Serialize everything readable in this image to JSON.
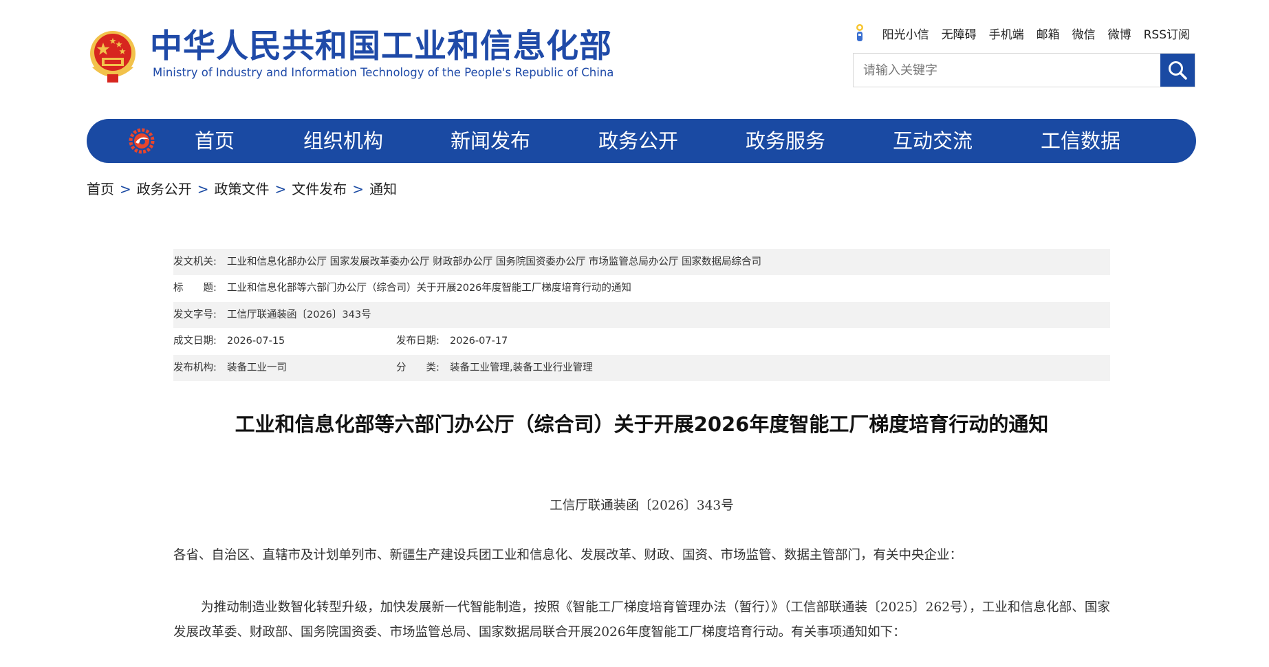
{
  "colors": {
    "brand_blue": "#1a4aa3",
    "title_blue": "#1f4aa8",
    "shade_gray": "#f2f2f2",
    "emblem_red": "#d7261f",
    "emblem_gold": "#f2c24b"
  },
  "header": {
    "title": "中华人民共和国工业和信息化部",
    "subtitle": "Ministry of Industry and Information Technology of the People's Republic of China",
    "links": [
      "阳光小信",
      "无障碍",
      "手机端",
      "邮箱",
      "微信",
      "微博",
      "RSS订阅"
    ],
    "search_placeholder": "请输入关键字",
    "emblem_icon": "national-emblem-icon",
    "search_icon": "search-icon"
  },
  "nav": {
    "logo_icon": "miit-logo-icon",
    "items": [
      "首页",
      "组织机构",
      "新闻发布",
      "政务公开",
      "政务服务",
      "互动交流",
      "工信数据"
    ]
  },
  "breadcrumb": [
    "首页",
    "政务公开",
    "政策文件",
    "文件发布",
    "通知"
  ],
  "breadcrumb_separator": ">",
  "meta": {
    "issuer_label": "发文机关:",
    "issuer": "工业和信息化部办公厅 国家发展改革委办公厅 财政部办公厅 国务院国资委办公厅 市场监管总局办公厅 国家数据局综合司",
    "title_label": "标　　题:",
    "title": "工业和信息化部等六部门办公厅（综合司）关于开展2026年度智能工厂梯度培育行动的通知",
    "docno_label": "发文字号:",
    "docno": "工信厅联通装函〔2026〕343号",
    "written_label": "成文日期:",
    "written": "2026-07-15",
    "published_label": "发布日期:",
    "published": "2026-07-17",
    "publisher_label": "发布机构:",
    "publisher": "装备工业一司",
    "category_label": "分　　类:",
    "category": "装备工业管理,装备工业行业管理"
  },
  "article": {
    "title": "工业和信息化部等六部门办公厅（综合司）关于开展2026年度智能工厂梯度培育行动的通知",
    "doc_number": "工信厅联通装函〔2026〕343号",
    "addressee": "各省、自治区、直辖市及计划单列市、新疆生产建设兵团工业和信息化、发展改革、财政、国资、市场监管、数据主管部门，有关中央企业：",
    "paragraph1": "为推动制造业数智化转型升级，加快发展新一代智能制造，按照《智能工厂梯度培育管理办法（暂行）》（工信部联通装〔2025〕262号），工业和信息化部、国家发展改革委、财政部、国务院国资委、市场监管总局、国家数据局联合开展2026年度智能工厂梯度培育行动。有关事项通知如下："
  }
}
